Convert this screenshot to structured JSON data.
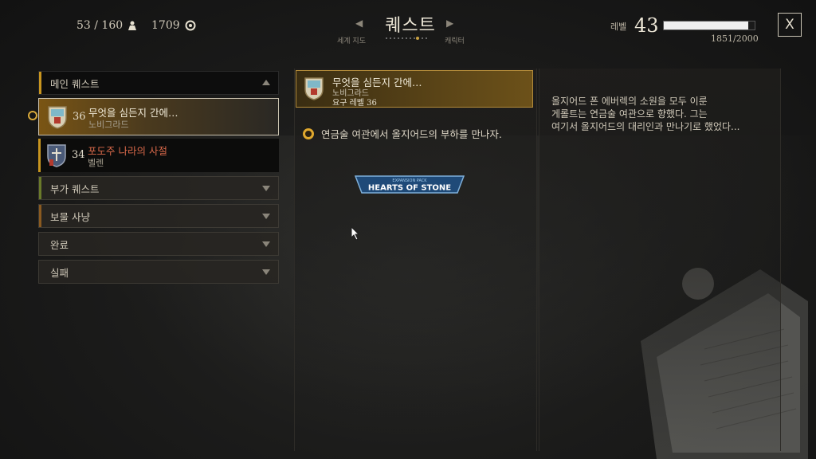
{
  "header": {
    "title": "퀘스트",
    "prev_tab": "세계 지도",
    "next_tab": "캐릭터",
    "weight": "53 / 160",
    "weight_icon": "weight-icon",
    "crowns": "1709",
    "crowns_icon": "crowns-icon",
    "level_label": "레벨",
    "level": "43",
    "xp": "1851/2000",
    "xp_fraction": 0.9255,
    "close_label": "X"
  },
  "sidebar": {
    "main_quests": "메인 퀘스트",
    "side_quests": "부가 퀘스트",
    "treasure_hunts": "보물 사냥",
    "completed": "완료",
    "failed": "실패",
    "quests": [
      {
        "level": "36",
        "name": "무엇을 심든지 간에…",
        "location": "노비그라드"
      },
      {
        "level": "34",
        "name": "포도주 나라의 사절",
        "location": "벨렌"
      }
    ]
  },
  "detail": {
    "quest_name": "무엇을 심든지 간에…",
    "location": "노비그라드",
    "required_level": "요구 레벨 36",
    "objective": "연금술 여관에서 올지어드의 부하를 만나자.",
    "expansion_top": "EXPANSION PACK",
    "expansion_name": "HEARTS OF STONE",
    "description": [
      "올지어드 폰 에버렉의 소원을 모두 이룬",
      "게롤트는 연금술 여관으로 향했다. 그는",
      "여기서 올지어드의 대리인과 만나기로 했었다..."
    ]
  },
  "colors": {
    "accent_gold": "#b38b3a",
    "main_quest_bar": "#c8951f",
    "side_quest_bar": "#6a7a2a",
    "treasure_bar": "#8a5a20"
  }
}
